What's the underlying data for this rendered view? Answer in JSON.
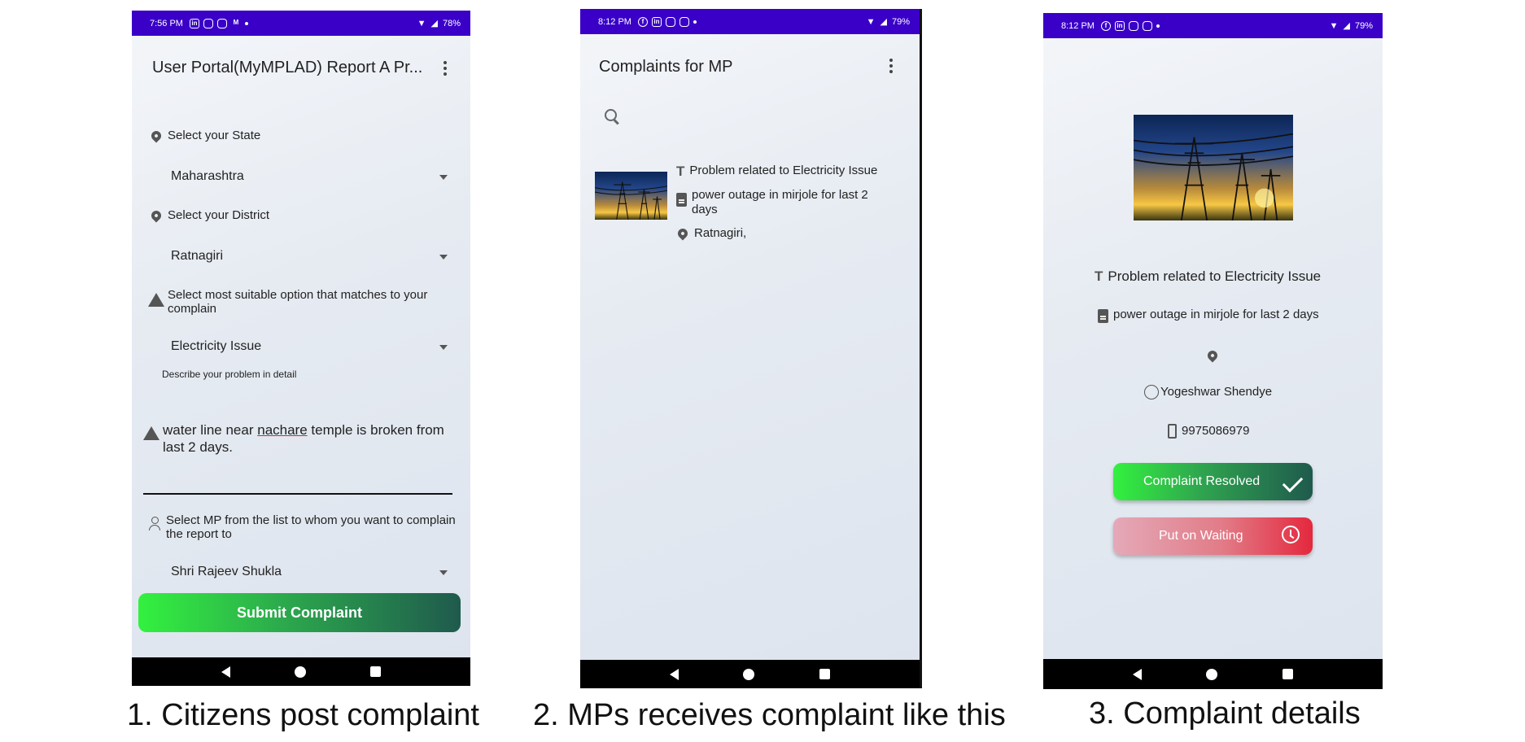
{
  "screens": [
    {
      "status": {
        "time": "7:56 PM",
        "battery": "78%"
      },
      "title": "User Portal(MyMPLAD) Report A Pr...",
      "state_label": "Select your State",
      "state_value": "Maharashtra",
      "district_label": "Select your District",
      "district_value": "Ratnagiri",
      "issue_label": "Select most suitable option that matches to your complain",
      "issue_value": "Electricity Issue",
      "describe_label": "Describe your problem in detail",
      "describe_text_1": "water line near ",
      "describe_text_word": "nachare",
      "describe_text_2": " temple is broken from last 2 days.",
      "mp_label": "Select MP from the list to whom you want to complain the report to",
      "mp_value": "Shri Rajeev Shukla",
      "submit_label": "Submit Complaint"
    },
    {
      "status": {
        "time": "8:12 PM",
        "battery": "79%"
      },
      "title": "Complaints for MP",
      "item": {
        "title": "Problem related to Electricity Issue",
        "description": "power outage in mirjole for last 2 days",
        "location": "Ratnagiri,"
      }
    },
    {
      "status": {
        "time": "8:12 PM",
        "battery": "79%"
      },
      "title": "Problem related to Electricity Issue",
      "description": "power outage in mirjole for last 2 days",
      "name": "Yogeshwar Shendye",
      "phone": "9975086979",
      "resolved_label": "Complaint Resolved",
      "waiting_label": "Put on Waiting"
    }
  ],
  "captions": [
    "1. Citizens post complaint",
    "2. MPs receives complaint like this",
    "3. Complaint details"
  ],
  "colors": {
    "status_bar": "#3a00c8",
    "submit_gradient": [
      "#33f13f",
      "#1f5a4d"
    ],
    "waiting_gradient": [
      "#e4a9b8",
      "#e4283d"
    ]
  }
}
